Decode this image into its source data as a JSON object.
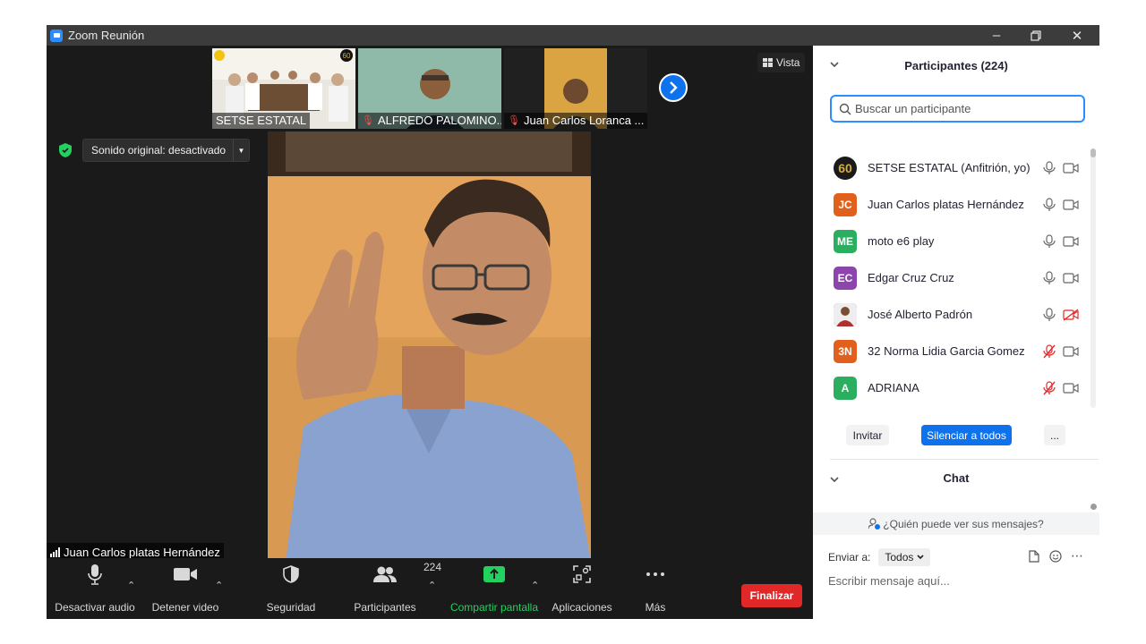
{
  "window": {
    "title": "Zoom Reunión"
  },
  "thumbnails": [
    {
      "name": "SETSE ESTATAL",
      "muted": false
    },
    {
      "name": "ALFREDO PALOMINO...",
      "muted": true
    },
    {
      "name": "Juan Carlos Loranca ...",
      "muted": true
    }
  ],
  "view_button": {
    "label": "Vista"
  },
  "sound_original": {
    "label": "Sonido original: desactivado"
  },
  "active_speaker": {
    "name": "Juan Carlos platas Hernández"
  },
  "toolbar": {
    "audio_label": "Desactivar audio",
    "video_label": "Detener video",
    "security_label": "Seguridad",
    "participants_label": "Participantes",
    "participants_count": "224",
    "share_label": "Compartir pantalla",
    "apps_label": "Aplicaciones",
    "more_label": "Más",
    "end_label": "Finalizar"
  },
  "participants_panel": {
    "title": "Participantes (224)",
    "search_placeholder": "Buscar un participante",
    "items": [
      {
        "initials": "60",
        "name": "SETSE ESTATAL (Anfitrión, yo)",
        "avatar_color": "#1a1a1a",
        "mic": "on",
        "cam": "on"
      },
      {
        "initials": "JC",
        "name": "Juan Carlos platas Hernández",
        "avatar_color": "#e0601c",
        "mic": "on",
        "cam": "on"
      },
      {
        "initials": "ME",
        "name": "moto e6 play",
        "avatar_color": "#2bae60",
        "mic": "on",
        "cam": "on"
      },
      {
        "initials": "EC",
        "name": "Edgar Cruz Cruz",
        "avatar_color": "#8e44ad",
        "mic": "on",
        "cam": "on"
      },
      {
        "initials": "",
        "name": "José Alberto Padrón",
        "avatar_color": "#c0392b",
        "mic": "on",
        "cam": "off"
      },
      {
        "initials": "3N",
        "name": "32 Norma Lidia Garcia Gomez",
        "avatar_color": "#e0601c",
        "mic": "muted",
        "cam": "on"
      },
      {
        "initials": "A",
        "name": "ADRIANA",
        "avatar_color": "#2bae60",
        "mic": "muted",
        "cam": "on"
      }
    ],
    "invite_label": "Invitar",
    "mute_all_label": "Silenciar a todos",
    "more_label": "..."
  },
  "chat": {
    "title": "Chat",
    "who_can_see": "¿Quién puede ver sus mensajes?",
    "send_to_label": "Enviar a:",
    "send_to_value": "Todos",
    "message_placeholder": "Escribir mensaje aquí..."
  }
}
